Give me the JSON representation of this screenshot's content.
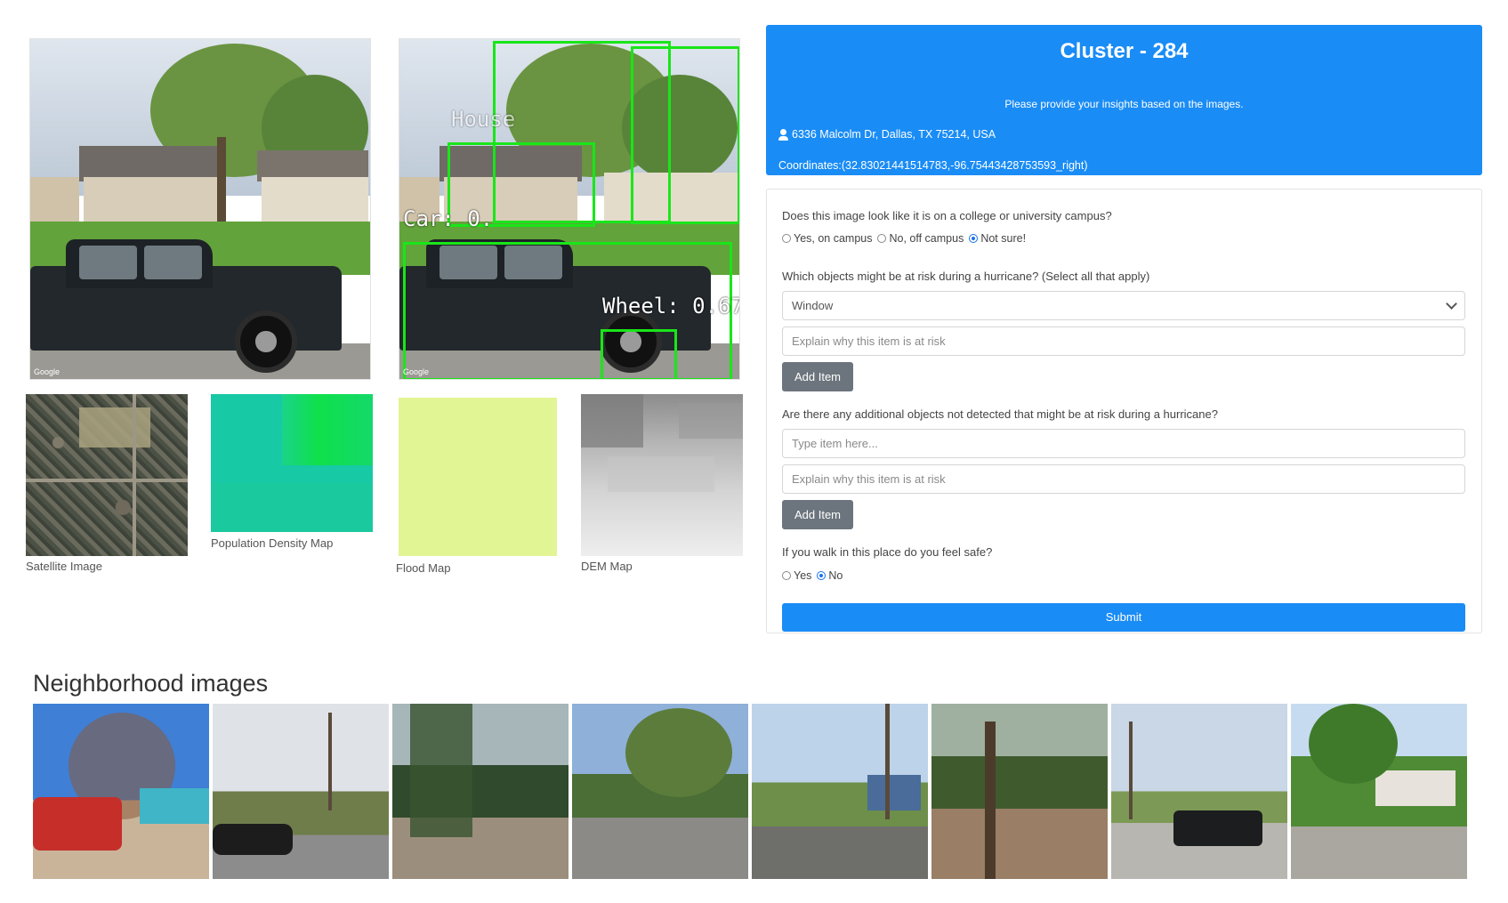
{
  "images": {
    "street_view": {
      "watermark": "Google"
    },
    "detection": {
      "watermark": "Google",
      "labels": {
        "house": "House",
        "car": "Car: 0.",
        "wheel": "Wheel: 0.67"
      }
    },
    "captions": {
      "satellite": "Satellite Image",
      "population": "Population Density Map",
      "flood": "Flood Map",
      "dem": "DEM Map"
    }
  },
  "header": {
    "title": "Cluster - 284",
    "subtitle": "Please provide your insights based on the images.",
    "address": "6336 Malcolm Dr, Dallas, TX 75214, USA",
    "coordinates": "Coordinates:(32.83021441514783,-96.75443428753593_right)"
  },
  "form": {
    "q1": {
      "label": "Does this image look like it is on a college or university campus?",
      "options": [
        "Yes, on campus",
        "No, off campus",
        "Not sure!"
      ],
      "selected": "Not sure!"
    },
    "q2": {
      "label": "Which objects might be at risk during a hurricane? (Select all that apply)",
      "select_value": "Window",
      "explain_placeholder": "Explain why this item is at risk",
      "add_button": "Add Item"
    },
    "q3": {
      "label": "Are there any additional objects not detected that might be at risk during a hurricane?",
      "item_placeholder": "Type item here...",
      "explain_placeholder": "Explain why this item is at risk",
      "add_button": "Add Item"
    },
    "q4": {
      "label": "If you walk in this place do you feel safe?",
      "options": [
        "Yes",
        "No"
      ],
      "selected": "No"
    },
    "submit_label": "Submit"
  },
  "neighborhood": {
    "title": "Neighborhood images",
    "image_count": 8
  },
  "colors": {
    "primary": "#1a8cf5",
    "secondary_button": "#6c757d",
    "detection_box": "#19e619",
    "population_map": "#17c9a4",
    "flood_map": "#e2f594"
  }
}
